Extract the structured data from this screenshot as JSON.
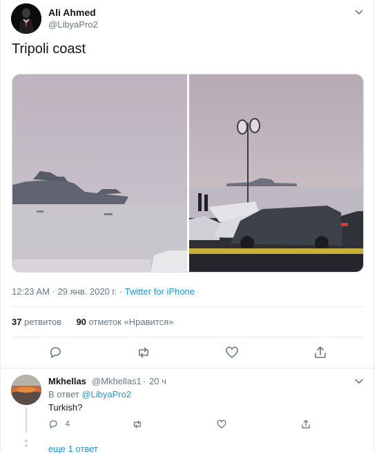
{
  "tweet": {
    "author_name": "Ali Ahmed",
    "author_handle": "@LibyaPro2",
    "text": "Tripoli coast",
    "timestamp": "12:23 AM · 29 янв. 2020 г. · ",
    "source": "Twitter for iPhone",
    "retweet_count": "37",
    "retweet_label": "ретвитов",
    "like_count": "90",
    "like_label": "отметок «Нравится»"
  },
  "reply": {
    "author_name": "Mkhellas",
    "author_handle": "@Mkhellas1",
    "separator": "·",
    "time": "20 ч",
    "reply_prefix": "В ответ",
    "reply_to": "@LibyaPro2",
    "text": "Turkish?",
    "reply_count": "4"
  },
  "more_replies": "еще 1 ответ",
  "icons": {
    "reply": "reply-icon",
    "retweet": "retweet-icon",
    "like": "heart-icon",
    "share": "share-icon",
    "menu": "chevron-down-icon"
  },
  "colors": {
    "link": "#1b95e0",
    "muted": "#657786",
    "text": "#14171a",
    "border": "#e6ecf0"
  }
}
